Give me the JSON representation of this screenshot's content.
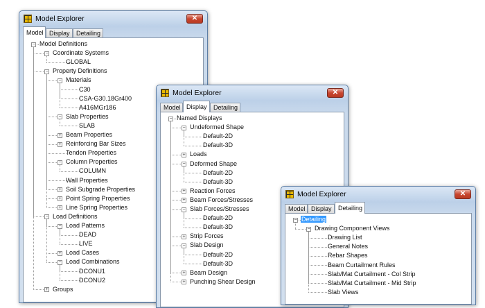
{
  "windows": [
    {
      "title": "Model Explorer",
      "close": "✕",
      "tabs": [
        "Model",
        "Display",
        "Detailing"
      ],
      "active_tab": 0,
      "tree": [
        {
          "label": "Model Definitions",
          "depth": 0,
          "expander": "minus"
        },
        {
          "label": "Coordinate Systems",
          "depth": 1,
          "expander": "minus"
        },
        {
          "label": "GLOBAL",
          "depth": 2
        },
        {
          "label": "Property Definitions",
          "depth": 1,
          "expander": "minus"
        },
        {
          "label": "Materials",
          "depth": 2,
          "expander": "minus"
        },
        {
          "label": "C30",
          "depth": 3
        },
        {
          "label": "CSA-G30.18Gr400",
          "depth": 3
        },
        {
          "label": "A416MGr186",
          "depth": 3
        },
        {
          "label": "Slab Properties",
          "depth": 2,
          "expander": "minus"
        },
        {
          "label": "SLAB",
          "depth": 3
        },
        {
          "label": "Beam Properties",
          "depth": 2,
          "expander": "plus"
        },
        {
          "label": "Reinforcing Bar Sizes",
          "depth": 2,
          "expander": "plus"
        },
        {
          "label": "Tendon Properties",
          "depth": 2
        },
        {
          "label": "Column Properties",
          "depth": 2,
          "expander": "minus"
        },
        {
          "label": "COLUMN",
          "depth": 3
        },
        {
          "label": "Wall Properties",
          "depth": 2
        },
        {
          "label": "Soil Subgrade Properties",
          "depth": 2,
          "expander": "plus"
        },
        {
          "label": "Point Spring Properties",
          "depth": 2,
          "expander": "plus"
        },
        {
          "label": "Line Spring Properties",
          "depth": 2,
          "expander": "plus"
        },
        {
          "label": "Load Definitions",
          "depth": 1,
          "expander": "minus"
        },
        {
          "label": "Load Patterns",
          "depth": 2,
          "expander": "minus"
        },
        {
          "label": "DEAD",
          "depth": 3
        },
        {
          "label": "LIVE",
          "depth": 3
        },
        {
          "label": "Load Cases",
          "depth": 2,
          "expander": "plus"
        },
        {
          "label": "Load Combinations",
          "depth": 2,
          "expander": "minus"
        },
        {
          "label": "DCONU1",
          "depth": 3
        },
        {
          "label": "DCONU2",
          "depth": 3
        },
        {
          "label": "Groups",
          "depth": 1,
          "expander": "plus"
        }
      ]
    },
    {
      "title": "Model Explorer",
      "close": "✕",
      "tabs": [
        "Model",
        "Display",
        "Detailing"
      ],
      "active_tab": 1,
      "tree": [
        {
          "label": "Named Displays",
          "depth": 0,
          "expander": "minus"
        },
        {
          "label": "Undeformed Shape",
          "depth": 1,
          "expander": "minus"
        },
        {
          "label": "Default-2D",
          "depth": 2
        },
        {
          "label": "Default-3D",
          "depth": 2
        },
        {
          "label": "Loads",
          "depth": 1,
          "expander": "plus"
        },
        {
          "label": "Deformed Shape",
          "depth": 1,
          "expander": "minus"
        },
        {
          "label": "Default-2D",
          "depth": 2
        },
        {
          "label": "Default-3D",
          "depth": 2
        },
        {
          "label": "Reaction Forces",
          "depth": 1,
          "expander": "plus"
        },
        {
          "label": "Beam Forces/Stresses",
          "depth": 1,
          "expander": "plus"
        },
        {
          "label": "Slab Forces/Stresses",
          "depth": 1,
          "expander": "minus"
        },
        {
          "label": "Default-2D",
          "depth": 2
        },
        {
          "label": "Default-3D",
          "depth": 2
        },
        {
          "label": "Strip Forces",
          "depth": 1,
          "expander": "plus"
        },
        {
          "label": "Slab Design",
          "depth": 1,
          "expander": "minus"
        },
        {
          "label": "Default-2D",
          "depth": 2
        },
        {
          "label": "Default-3D",
          "depth": 2
        },
        {
          "label": "Beam Design",
          "depth": 1,
          "expander": "plus"
        },
        {
          "label": "Punching Shear Design",
          "depth": 1,
          "expander": "plus"
        }
      ]
    },
    {
      "title": "Model Explorer",
      "close": "✕",
      "tabs": [
        "Model",
        "Display",
        "Detailing"
      ],
      "active_tab": 2,
      "tree": [
        {
          "label": "Detailing",
          "depth": 0,
          "expander": "minus",
          "selected": true
        },
        {
          "label": "Drawing Component Views",
          "depth": 1,
          "expander": "minus"
        },
        {
          "label": "Drawing List",
          "depth": 2
        },
        {
          "label": "General Notes",
          "depth": 2
        },
        {
          "label": "Rebar Shapes",
          "depth": 2
        },
        {
          "label": "Beam Curtailment Rules",
          "depth": 2
        },
        {
          "label": "Slab/Mat Curtailment - Col Strip",
          "depth": 2
        },
        {
          "label": "Slab/Mat Curtailment - Mid Strip",
          "depth": 2
        },
        {
          "label": "Slab Views",
          "depth": 2
        }
      ]
    }
  ]
}
